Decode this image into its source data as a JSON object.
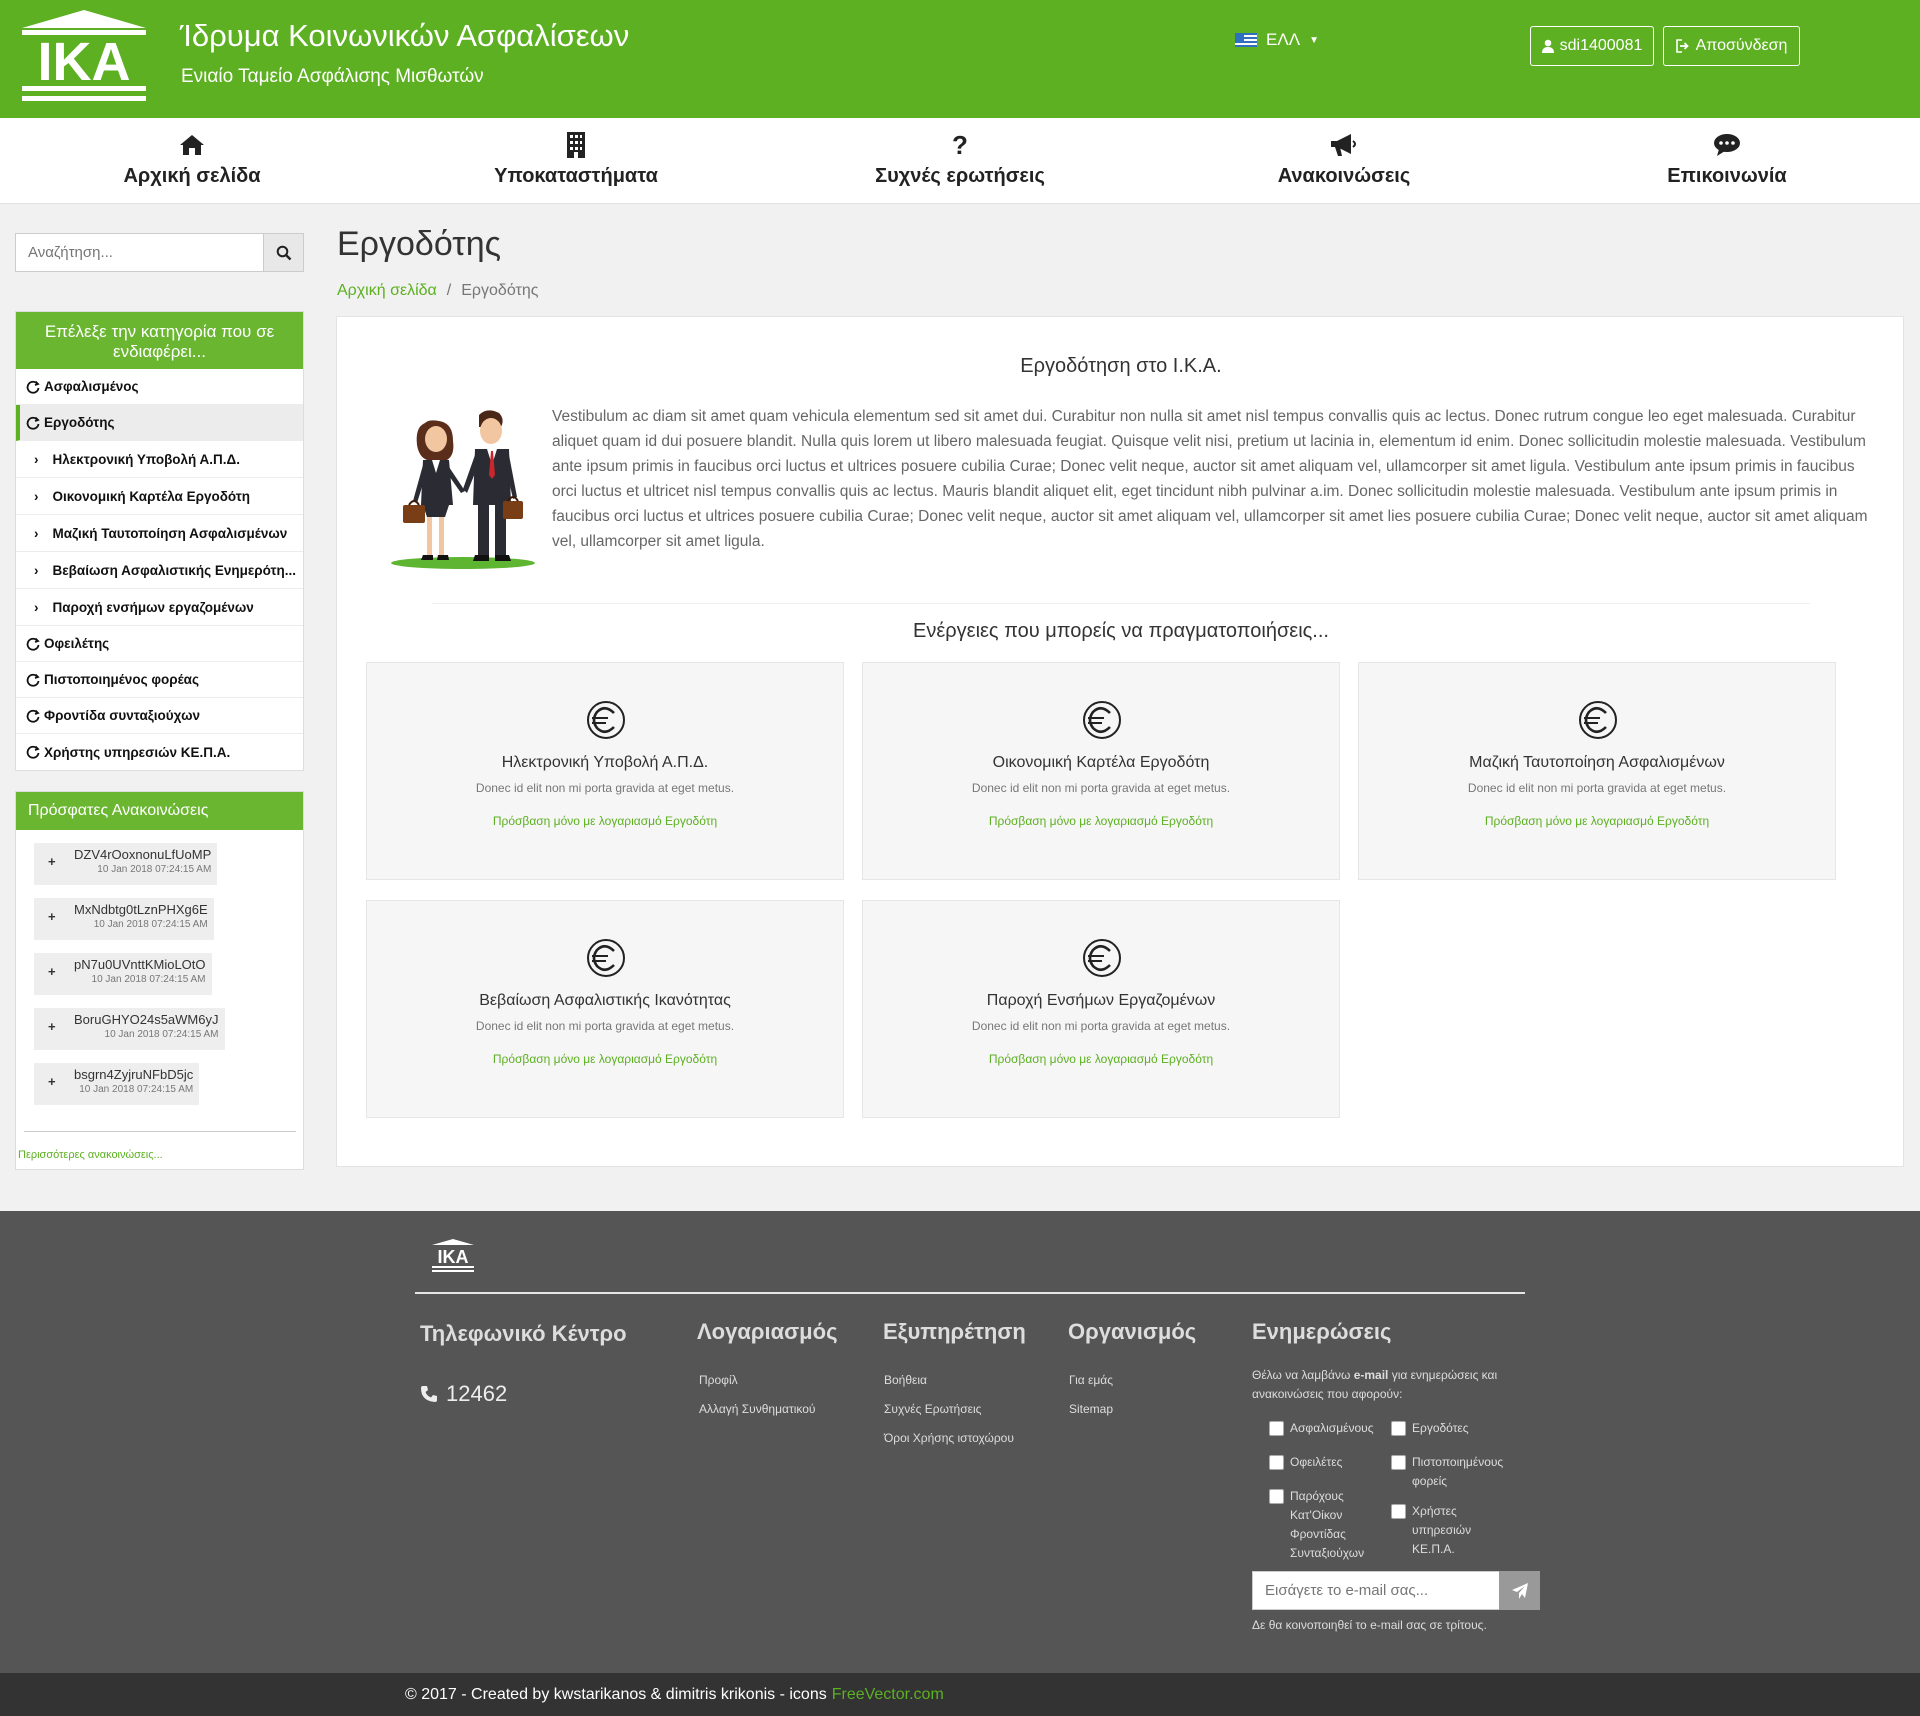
{
  "header": {
    "logo_text": "ΙΚΑ",
    "org_title": "Ίδρυμα Κοινωνικών Ασφαλίσεων",
    "org_subtitle": "Ενιαίο Ταμείο Ασφάλισης Μισθωτών",
    "language": "ΕΛΛ",
    "user_label": "sdi1400081",
    "logout_label": "Αποσύνδεση",
    "brand_color": "#5cb021"
  },
  "nav": {
    "items": [
      {
        "label": "Αρχική σελίδα",
        "icon": "home-icon"
      },
      {
        "label": "Υποκαταστήματα",
        "icon": "building-icon"
      },
      {
        "label": "Συχνές ερωτήσεις",
        "icon": "question-icon"
      },
      {
        "label": "Ανακοινώσεις",
        "icon": "bullhorn-icon"
      },
      {
        "label": "Επικοινωνία",
        "icon": "comment-icon"
      }
    ]
  },
  "search": {
    "placeholder": "Αναζήτηση..."
  },
  "sidebar": {
    "heading": "Επέλεξε την κατηγορία που σε ενδιαφέρει...",
    "categories": [
      "Ασφαλισμένος",
      "Εργοδότης",
      "Οφειλέτης",
      "Πιστοποιημένος φορέας",
      "Φροντίδα συνταξιούχων",
      "Χρήστης υπηρεσιών ΚΕ.Π.Α."
    ],
    "subitems": [
      "Ηλεκτρονική Υποβολή Α.Π.Δ.",
      "Οικονομική Καρτέλα Εργοδότη",
      "Μαζική Ταυτοποίηση Ασφαλισμένων",
      "Βεβαίωση Ασφαλιστικής Ενημερότη...",
      "Παροχή ενσήμων εργαζομένων"
    ]
  },
  "announcements": {
    "heading": "Πρόσφατες Ανακοινώσεις",
    "items": [
      {
        "code": "DZV4rOoxnonuLfUoMP",
        "date": "10 Jan 2018 07:24:15 AM"
      },
      {
        "code": "MxNdbtg0tLznPHXg6E",
        "date": "10 Jan 2018 07:24:15 AM"
      },
      {
        "code": "pN7u0UVnttKMioLOtO",
        "date": "10 Jan 2018 07:24:15 AM"
      },
      {
        "code": "BoruGHYO24s5aWM6yJ",
        "date": "10 Jan 2018 07:24:15 AM"
      },
      {
        "code": "bsgrn4ZyjruNFbD5jc",
        "date": "10 Jan 2018 07:24:15 AM"
      }
    ],
    "more_label": "Περισσότερες ανακοινώσεις..."
  },
  "page": {
    "title": "Εργοδότης",
    "breadcrumb_home": "Αρχική σελίδα",
    "breadcrumb_sep": "/",
    "breadcrumb_current": "Εργοδότης"
  },
  "intro": {
    "heading": "Εργοδότηση στο Ι.Κ.Α.",
    "text": "Vestibulum ac diam sit amet quam vehicula elementum sed sit amet dui. Curabitur non nulla sit amet nisl tempus convallis quis ac lectus. Donec rutrum congue leo eget malesuada. Curabitur aliquet quam id dui posuere blandit. Nulla quis lorem ut libero malesuada feugiat. Quisque velit nisi, pretium ut lacinia in, elementum id enim. Donec sollicitudin molestie malesuada. Vestibulum ante ipsum primis in faucibus orci luctus et ultrices posuere cubilia Curae; Donec velit neque, auctor sit amet aliquam vel, ullamcorper sit amet ligula. Vestibulum ante ipsum primis in faucibus orci luctus et ultricet nisl tempus convallis quis ac lectus. Mauris blandit aliquet elit, eget tincidunt nibh pulvinar a.im. Donec sollicitudin molestie malesuada. Vestibulum ante ipsum primis in faucibus orci luctus et ultrices posuere cubilia Curae; Donec velit neque, auctor sit amet aliquam vel, ullamcorper sit amet lies posuere cubilia Curae; Donec velit neque, auctor sit amet aliquam vel, ullamcorper sit amet ligula."
  },
  "actions": {
    "heading": "Ενέργειες που μπορείς να πραγματοποιήσεις...",
    "cards": [
      {
        "title": "Ηλεκτρονική Υποβολή Α.Π.Δ.",
        "desc": "Donec id elit non mi porta gravida at eget metus.",
        "link": "Πρόσβαση μόνο με λογαριασμό Εργοδότη"
      },
      {
        "title": "Οικονομική Καρτέλα Εργοδότη",
        "desc": "Donec id elit non mi porta gravida at eget metus.",
        "link": "Πρόσβαση μόνο με λογαριασμό Εργοδότη"
      },
      {
        "title": "Μαζική Ταυτοποίηση Ασφαλισμένων",
        "desc": "Donec id elit non mi porta gravida at eget metus.",
        "link": "Πρόσβαση μόνο με λογαριασμό Εργοδότη"
      },
      {
        "title": "Βεβαίωση Ασφαλιστικής Ικανότητας",
        "desc": "Donec id elit non mi porta gravida at eget metus.",
        "link": "Πρόσβαση μόνο με λογαριασμό Εργοδότη"
      },
      {
        "title": "Παροχή Ενσήμων Εργαζομένων",
        "desc": "Donec id elit non mi porta gravida at eget metus.",
        "link": "Πρόσβαση μόνο με λογαριασμό Εργοδότη"
      }
    ]
  },
  "footer": {
    "logo_text": "ΙΚΑ",
    "phone_heading": "Τηλεφωνικό Κέντρο",
    "phone_number": "12462",
    "account_heading": "Λογαριασμός",
    "account_links": [
      "Προφίλ",
      "Αλλαγή Συνθηματικού"
    ],
    "service_heading": "Εξυπηρέτηση",
    "service_links": [
      "Βοήθεια",
      "Συχνές Ερωτήσεις",
      "Όροι Χρήσης ιστοχώρου"
    ],
    "org_heading": "Οργανισμός",
    "org_links": [
      "Για εμάς",
      "Sitemap"
    ],
    "updates_heading": "Ενημερώσεις",
    "updates_text_pre": "Θέλω να λαμβάνω ",
    "updates_text_bold": "e-mail",
    "updates_text_post": " για ενημερώσεις και ανακοινώσεις που αφορούν:",
    "checkboxes": [
      "Ασφαλισμένους",
      "Εργοδότες",
      "Οφειλέτες",
      "Πιστοποιημένους φορείς",
      "Παρόχους Κατ'Οίκον Φροντίδας Συνταξιούχων",
      "Χρήστες υπηρεσιών ΚΕ.Π.Α."
    ],
    "email_placeholder": "Εισάγετε το e-mail σας...",
    "privacy_note": "Δε θα κοινοποιηθεί το e-mail σας σε τρίτους."
  },
  "copyright": {
    "text": "© 2017 - Created by kwstarikanos & dimitris krikonis - icons",
    "link": "FreeVector.com"
  }
}
